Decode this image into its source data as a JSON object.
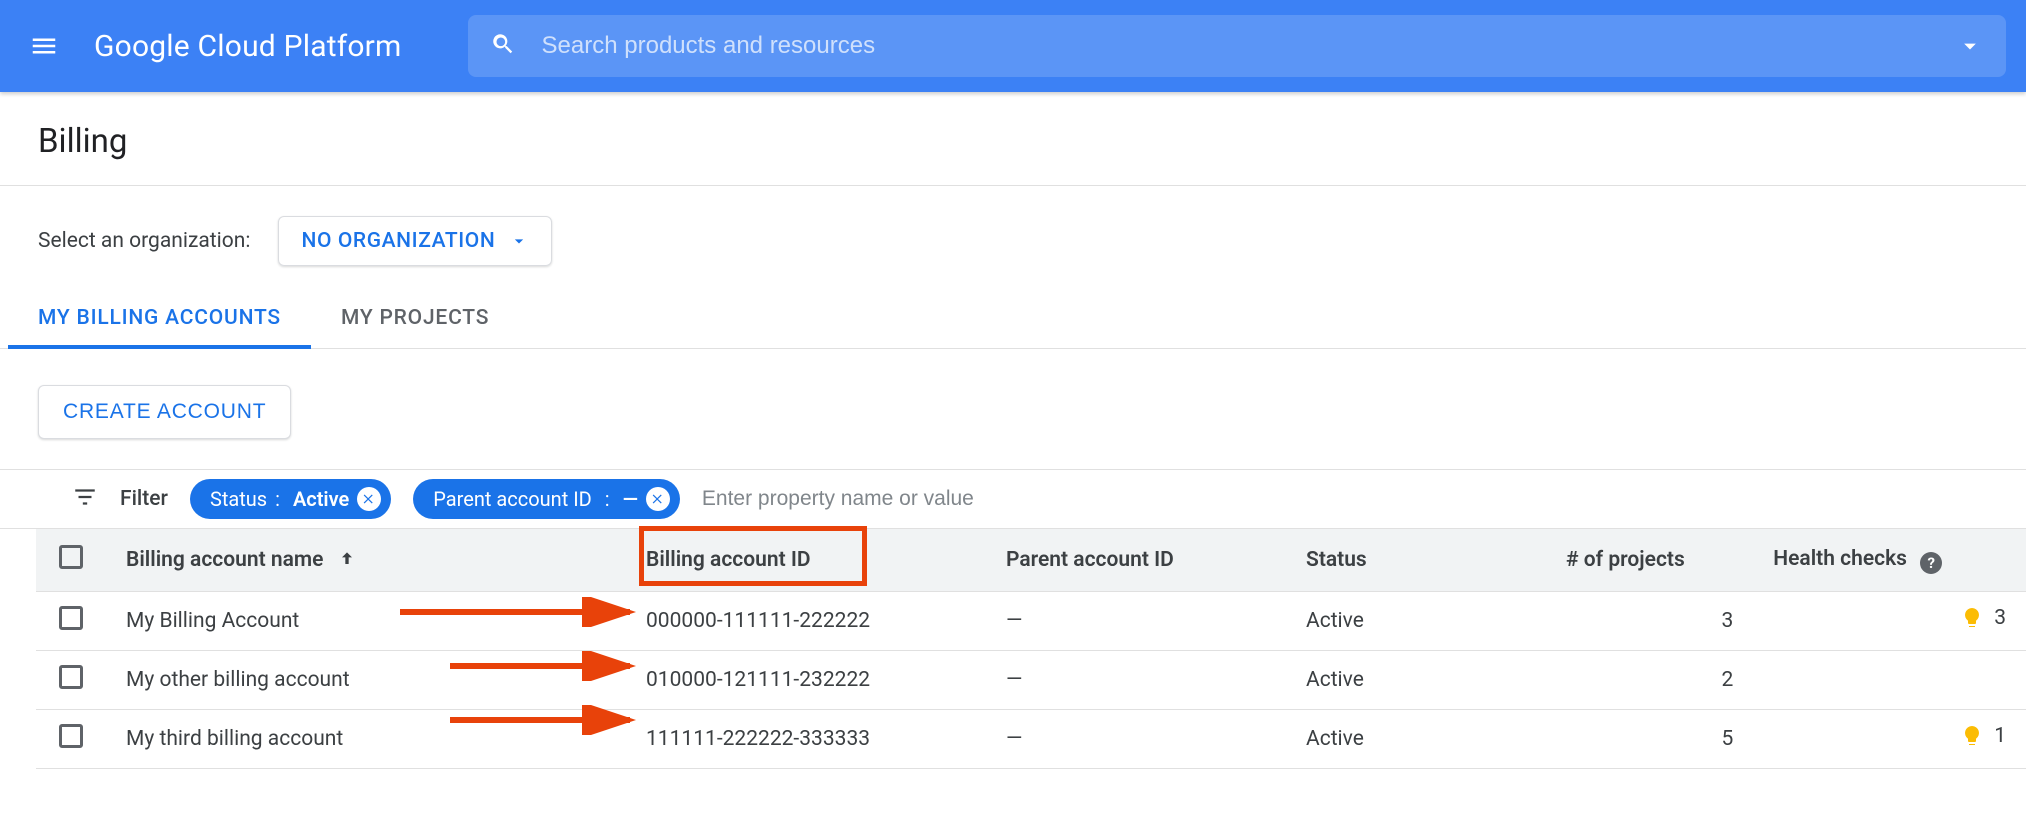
{
  "app_title": "Google Cloud Platform",
  "search_placeholder": "Search products and resources",
  "page_title": "Billing",
  "org": {
    "label": "Select an organization:",
    "selected": "NO ORGANIZATION"
  },
  "tabs": {
    "billing": "MY BILLING ACCOUNTS",
    "projects": "MY PROJECTS"
  },
  "create_button": "CREATE ACCOUNT",
  "filter": {
    "label": "Filter",
    "chips": [
      {
        "key": "Status",
        "value": "Active"
      },
      {
        "key": "Parent account ID",
        "value": "—"
      }
    ],
    "placeholder": "Enter property name or value"
  },
  "table": {
    "headers": {
      "name": "Billing account name",
      "bid": "Billing account ID",
      "pid": "Parent account ID",
      "status": "Status",
      "projects": "# of projects",
      "health": "Health checks"
    },
    "rows": [
      {
        "name": "My Billing Account",
        "bid": "000000-111111-222222",
        "pid": "—",
        "status": "Active",
        "projects": "3",
        "health": "3"
      },
      {
        "name": "My other billing account",
        "bid": "010000-121111-232222",
        "pid": "—",
        "status": "Active",
        "projects": "2",
        "health": ""
      },
      {
        "name": "My third billing account",
        "bid": "111111-222222-333333",
        "pid": "—",
        "status": "Active",
        "projects": "5",
        "health": "1"
      }
    ]
  }
}
